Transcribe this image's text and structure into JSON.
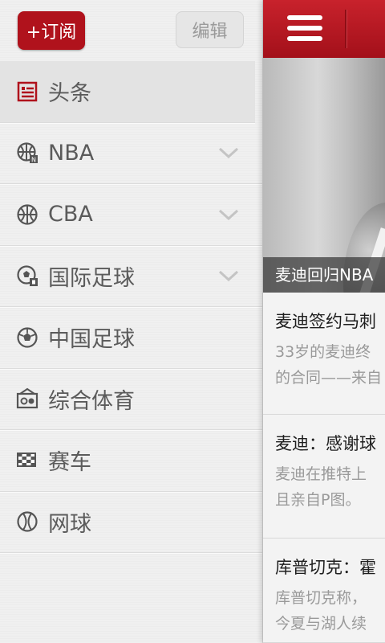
{
  "drawer": {
    "subscribe_label": "+订阅",
    "edit_label": "编辑",
    "items": [
      {
        "label": "头条",
        "icon": "headline-icon",
        "has_chevron": false,
        "active": true
      },
      {
        "label": "NBA",
        "icon": "nba-basketball-icon",
        "has_chevron": true
      },
      {
        "label": "CBA",
        "icon": "basketball-icon",
        "has_chevron": true
      },
      {
        "label": "国际足球",
        "icon": "international-football-icon",
        "has_chevron": true
      },
      {
        "label": "中国足球",
        "icon": "football-icon",
        "has_chevron": false
      },
      {
        "label": "综合体育",
        "icon": "sports-icon",
        "has_chevron": false
      },
      {
        "label": "赛车",
        "icon": "racing-flag-icon",
        "has_chevron": false
      },
      {
        "label": "网球",
        "icon": "tennis-icon",
        "has_chevron": false
      }
    ]
  },
  "content": {
    "hero_caption": "麦迪回归NBA",
    "news": [
      {
        "title": "麦迪签约马刺",
        "desc_line1": "33岁的麦迪终",
        "desc_line2": "的合同——来自"
      },
      {
        "title": "麦迪：感谢球",
        "desc_line1": "麦迪在推特上",
        "desc_line2": "且亲自P图。"
      },
      {
        "title": "库普切克：霍",
        "desc_line1": "库普切克称，",
        "desc_line2": "今夏与湖人续"
      }
    ]
  },
  "colors": {
    "accent": "#b0121c",
    "topbar": "#b8161f",
    "label": "#5b5b5b"
  }
}
